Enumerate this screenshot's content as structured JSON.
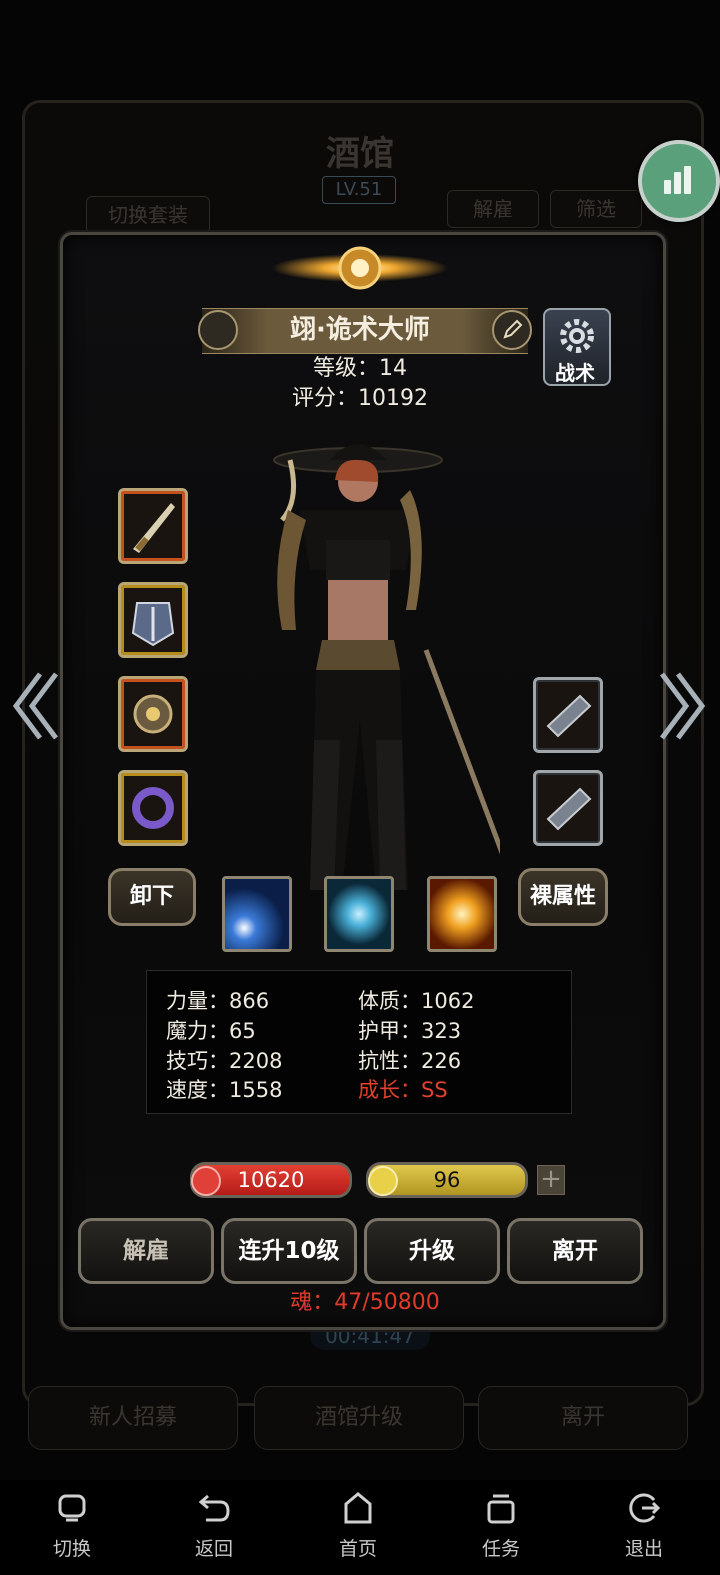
{
  "background": {
    "title": "酒馆",
    "level": "LV.51",
    "switch_set": "切换套装",
    "dismiss": "解雇",
    "filter": "筛选",
    "timer": "00:41:47",
    "bottom_buttons": [
      "新人招募",
      "酒馆升级",
      "离开"
    ]
  },
  "hero": {
    "name": "翊·诡术大师",
    "level_text": "等级：14",
    "score_text": "评分：10192",
    "tactics": "战术"
  },
  "buttons": {
    "unequip": "卸下",
    "naked_attr": "裸属性"
  },
  "stats": {
    "strength": "力量：866",
    "magic": "魔力：65",
    "skill": "技巧：2208",
    "speed": "速度：1558",
    "constitution": "体质：1062",
    "armor": "护甲：323",
    "resistance": "抗性：226",
    "growth": "成长：SS"
  },
  "bars": {
    "hp": "10620",
    "energy": "96",
    "plus": "+"
  },
  "actions": [
    "解雇",
    "连升10级",
    "升级",
    "离开"
  ],
  "soul": "魂：47/50800",
  "system_nav": {
    "switch": "切换",
    "back": "返回",
    "home": "首页",
    "tasks": "任务",
    "exit": "退出"
  },
  "colors": {
    "accent_gold": "#b9a576",
    "growth_red": "#e0402c",
    "hp_red": "#d2302a",
    "energy_yellow": "#d4bc3a"
  }
}
